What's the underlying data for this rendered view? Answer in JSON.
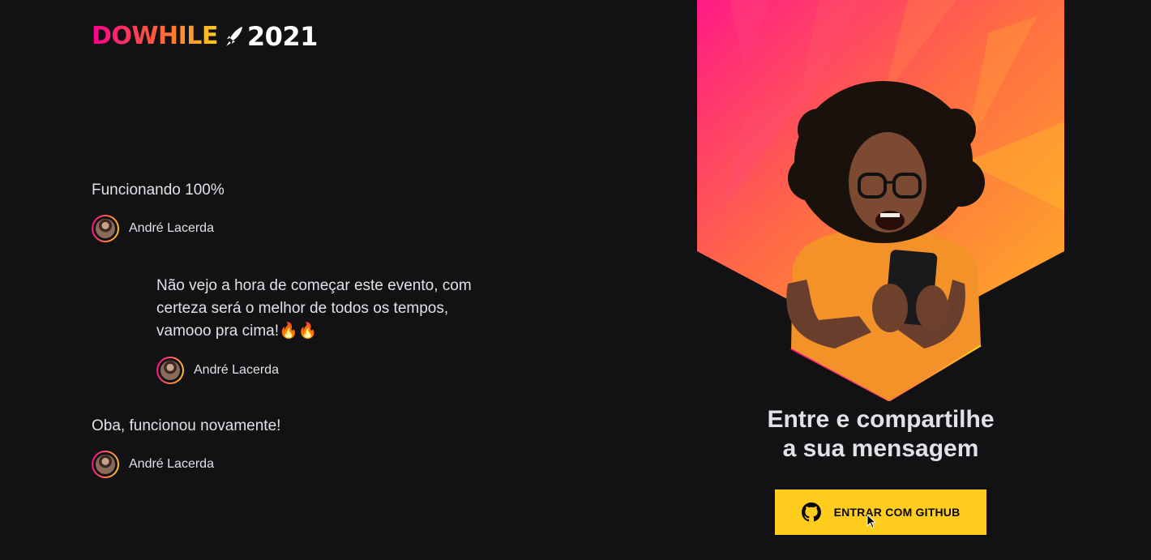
{
  "logo": {
    "brand": "DOWHILE",
    "year": "2021"
  },
  "messages": [
    {
      "text": "Funcionando 100%",
      "author": "André Lacerda"
    },
    {
      "text": "Não vejo a hora de começar este evento, com certeza será o melhor de todos os tempos, vamooo pra cima!🔥🔥",
      "author": "André Lacerda"
    },
    {
      "text": "Oba, funcionou novamente!",
      "author": "André Lacerda"
    }
  ],
  "login": {
    "title_line1": "Entre e compartilhe",
    "title_line2": "a sua mensagem",
    "button_label": "ENTRAR COM GITHUB"
  },
  "colors": {
    "background": "#121214",
    "accent_pink": "#ff008e",
    "accent_yellow": "#ffcd1e",
    "text": "#e1e1e6"
  },
  "icons": [
    "rocket-icon",
    "github-icon",
    "cursor-icon"
  ]
}
